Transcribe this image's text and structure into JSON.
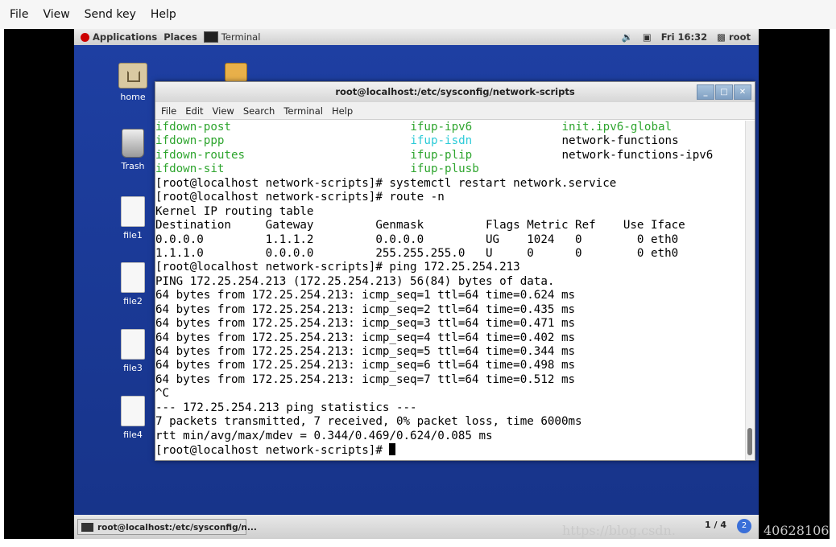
{
  "viewer_menu": [
    "File",
    "View",
    "Send key",
    "Help"
  ],
  "topbar": {
    "applications": "Applications",
    "places": "Places",
    "terminal": "Terminal",
    "clock": "Fri 16:32",
    "user": "root"
  },
  "desktop_icons": [
    "home",
    "Trash",
    "file1",
    "file2",
    "file3",
    "file4"
  ],
  "window": {
    "title": "root@localhost:/etc/sysconfig/network-scripts",
    "menu": [
      "File",
      "Edit",
      "View",
      "Search",
      "Terminal",
      "Help"
    ]
  },
  "terminal": {
    "listing": [
      [
        {
          "t": "ifdown-post",
          "c": "g"
        },
        {
          "t": "ifup-ipv6",
          "c": "g"
        },
        {
          "t": "init.ipv6-global",
          "c": "g"
        }
      ],
      [
        {
          "t": "ifdown-ppp",
          "c": "g"
        },
        {
          "t": "ifup-isdn",
          "c": "c"
        },
        {
          "t": "network-functions",
          "c": ""
        }
      ],
      [
        {
          "t": "ifdown-routes",
          "c": "g"
        },
        {
          "t": "ifup-plip",
          "c": "g"
        },
        {
          "t": "network-functions-ipv6",
          "c": ""
        }
      ],
      [
        {
          "t": "ifdown-sit",
          "c": "g"
        },
        {
          "t": "ifup-plusb",
          "c": "g"
        },
        {
          "t": "",
          "c": ""
        }
      ]
    ],
    "lines": [
      "[root@localhost network-scripts]# systemctl restart network.service",
      "[root@localhost network-scripts]# route -n",
      "Kernel IP routing table",
      "Destination     Gateway         Genmask         Flags Metric Ref    Use Iface",
      "0.0.0.0         1.1.1.2         0.0.0.0         UG    1024   0        0 eth0",
      "1.1.1.0         0.0.0.0         255.255.255.0   U     0      0        0 eth0",
      "[root@localhost network-scripts]# ping 172.25.254.213",
      "PING 172.25.254.213 (172.25.254.213) 56(84) bytes of data.",
      "64 bytes from 172.25.254.213: icmp_seq=1 ttl=64 time=0.624 ms",
      "64 bytes from 172.25.254.213: icmp_seq=2 ttl=64 time=0.435 ms",
      "64 bytes from 172.25.254.213: icmp_seq=3 ttl=64 time=0.471 ms",
      "64 bytes from 172.25.254.213: icmp_seq=4 ttl=64 time=0.402 ms",
      "64 bytes from 172.25.254.213: icmp_seq=5 ttl=64 time=0.344 ms",
      "64 bytes from 172.25.254.213: icmp_seq=6 ttl=64 time=0.498 ms",
      "64 bytes from 172.25.254.213: icmp_seq=7 ttl=64 time=0.512 ms",
      "^C",
      "--- 172.25.254.213 ping statistics ---",
      "7 packets transmitted, 7 received, 0% packet loss, time 6000ms",
      "rtt min/avg/max/mdev = 0.344/0.469/0.624/0.085 ms"
    ],
    "prompt": "[root@localhost network-scripts]# "
  },
  "taskbar": {
    "task": "root@localhost:/etc/sysconfig/n...",
    "pager": "1 / 4",
    "pager_badge": "2"
  },
  "watermark": "https://blog.csdn.",
  "watermark_suffix": "40628106",
  "colors": {
    "desktop": "#1a3a8e",
    "green": "#2ea52e",
    "cyan": "#2ecbd8"
  }
}
